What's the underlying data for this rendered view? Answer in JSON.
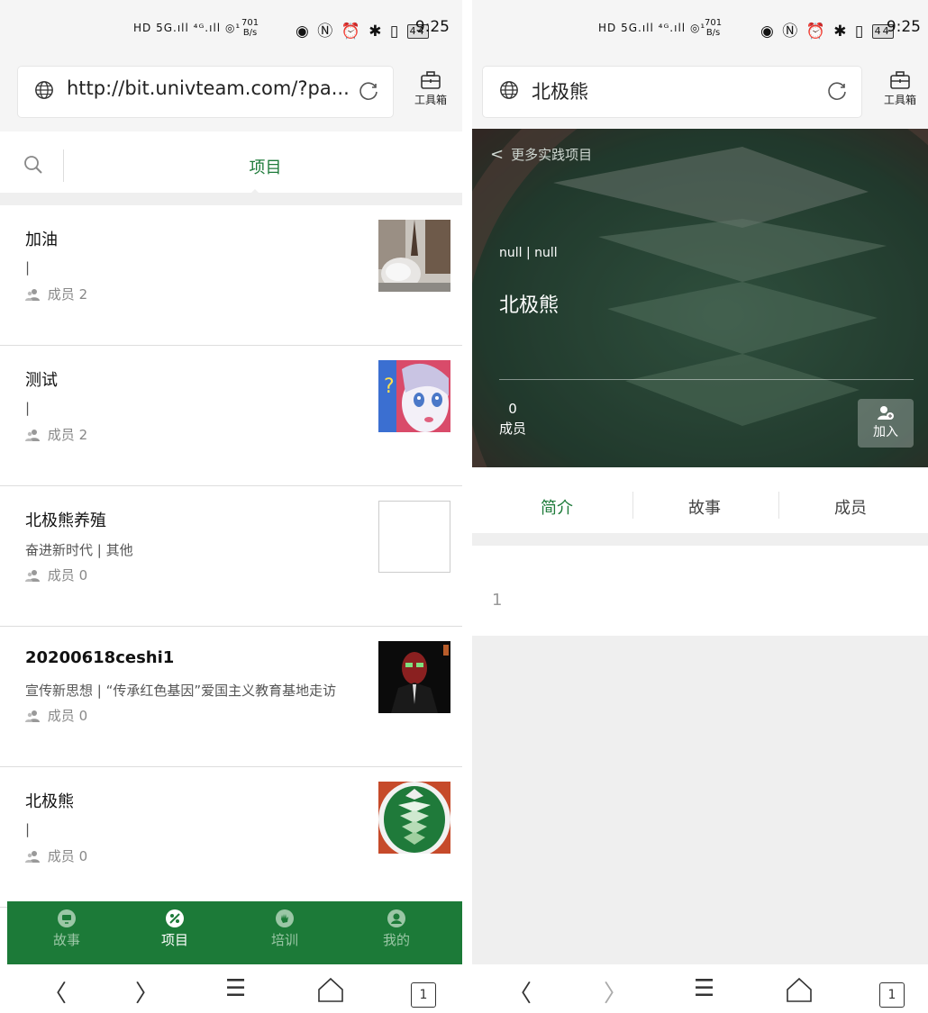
{
  "left": {
    "status": {
      "network_speed": "701\nB/s",
      "time": "9:25",
      "battery": "44"
    },
    "browser": {
      "url": "http://bit.univteam.com/?pa...",
      "toolbox_label": "工具箱"
    },
    "header": {
      "title": "项目"
    },
    "projects": [
      {
        "name": "加油",
        "meta": "|",
        "members_label": "成员",
        "members_count": "2",
        "thumb": "photo-plants"
      },
      {
        "name": "测试",
        "meta": "|",
        "members_label": "成员",
        "members_count": "2",
        "thumb": "anime-girl"
      },
      {
        "name": "北极熊养殖",
        "meta": "奋进新时代 | 其他",
        "members_label": "成员",
        "members_count": "0",
        "thumb": "empty"
      },
      {
        "name": "20200618ceshi1",
        "meta": "宣传新思想 | “传承红色基因”爱国主义教育基地走访",
        "members_label": "成员",
        "members_count": "0",
        "thumb": "man-in-suit"
      },
      {
        "name": "北极熊",
        "meta": "|",
        "members_label": "成员",
        "members_count": "0",
        "thumb": "green-emblem"
      }
    ],
    "bottom_nav": [
      {
        "label": "故事",
        "icon": "chat-icon",
        "active": false
      },
      {
        "label": "项目",
        "icon": "project-icon",
        "active": true
      },
      {
        "label": "培训",
        "icon": "hand-icon",
        "active": false
      },
      {
        "label": "我的",
        "icon": "user-icon",
        "active": false
      }
    ]
  },
  "right": {
    "status": {
      "network_speed": "701\nB/s",
      "time": "9:25",
      "battery": "44"
    },
    "browser": {
      "title": "北极熊",
      "toolbox_label": "工具箱"
    },
    "hero": {
      "back_label": "更多实践项目",
      "category": "null | null",
      "title": "北极熊",
      "members_count": "0",
      "members_label": "成员",
      "join_label": "加入"
    },
    "tabs": [
      "简介",
      "故事",
      "成员"
    ],
    "intro_text": "1"
  },
  "system_nav": {
    "tab_count": "1"
  },
  "colors": {
    "primary_green": "#1c7a38",
    "tab_green": "#1e7b3a",
    "background_gray": "#efefef"
  }
}
